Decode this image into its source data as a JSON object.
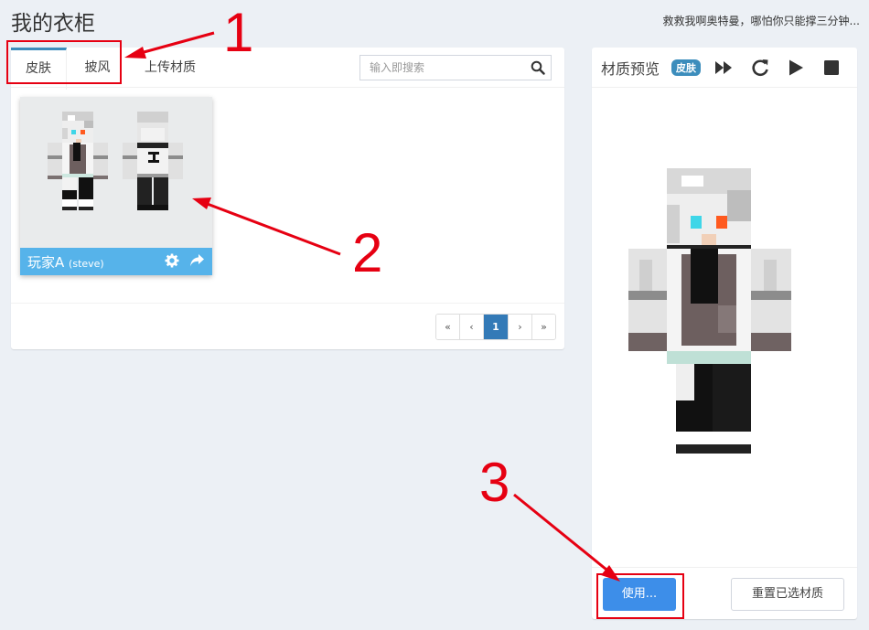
{
  "page": {
    "title": "我的衣柜",
    "motto": "救救我啊奥特曼，哪怕你只能撑三分钟..."
  },
  "tabs": [
    {
      "label": "皮肤",
      "active": true
    },
    {
      "label": "披风",
      "active": false
    },
    {
      "label": "上传材质",
      "active": false
    }
  ],
  "search": {
    "placeholder": "输入即搜索",
    "icon": "search-icon"
  },
  "card": {
    "name": "玩家A",
    "model": "(steve)",
    "icons": [
      "gear-icon",
      "share-icon"
    ]
  },
  "pagination": {
    "first": "«",
    "prev": "‹",
    "current": "1",
    "next": "›",
    "last": "»"
  },
  "preview": {
    "title": "材质预览",
    "badge": "皮肤",
    "controls": [
      "fast-forward-icon",
      "rotate-icon",
      "play-icon",
      "stop-icon"
    ],
    "use_label": "使用...",
    "reset_label": "重置已选材质"
  },
  "annotations": [
    "1",
    "2",
    "3"
  ],
  "colors": {
    "accent": "#3c8dbc",
    "card_footer": "#56b3ea",
    "use_button": "#3d8ee9",
    "annotation": "#e60012",
    "background": "#ecf0f5"
  }
}
